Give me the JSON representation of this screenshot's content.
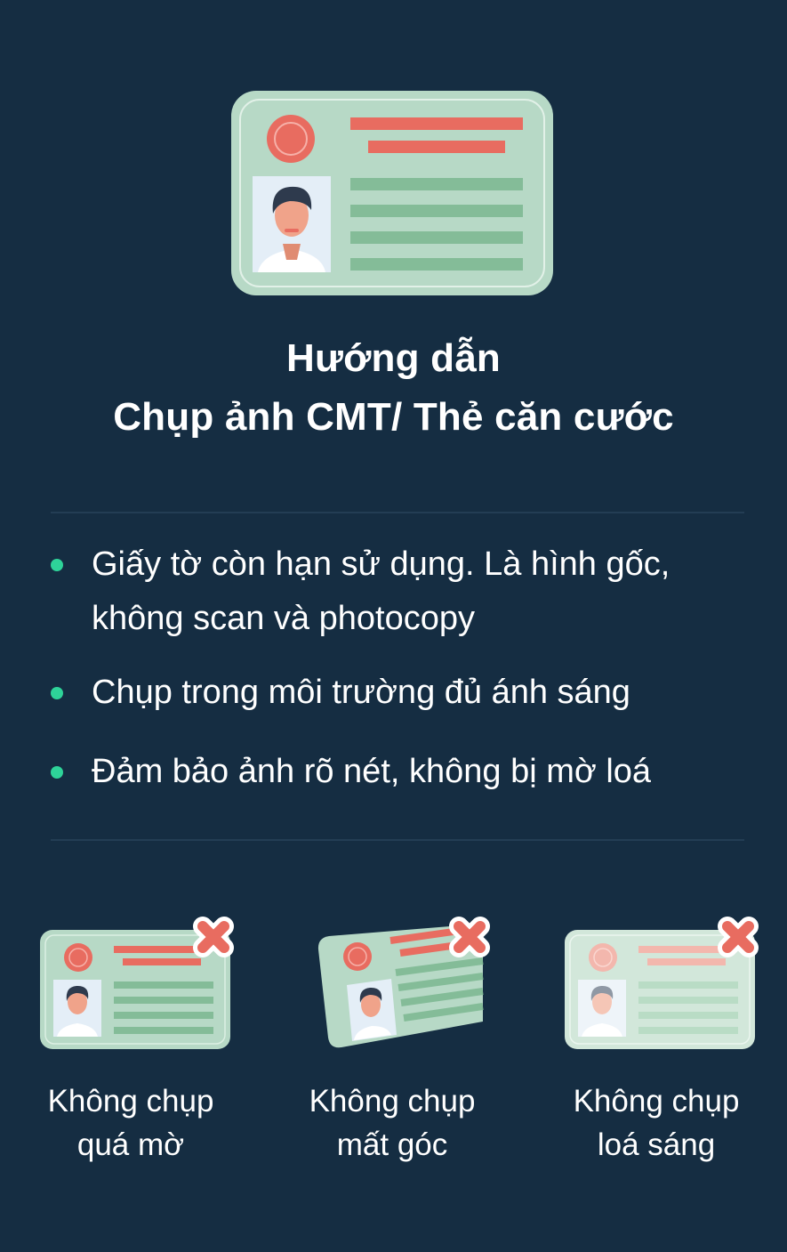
{
  "guide": {
    "title_line1": "Hướng dẫn",
    "title_line2": "Chụp ảnh CMT/ Thẻ căn cước"
  },
  "tips": [
    {
      "line1": "Giấy tờ còn hạn sử dụng. Là hình gốc,",
      "line2": "không scan và photocopy"
    },
    {
      "line1": "Chụp trong môi trường đủ ánh sáng"
    },
    {
      "line1": "Đảm bảo ảnh rõ nét, không bị mờ loá"
    }
  ],
  "warnings": [
    {
      "line1": "Không chụp",
      "line2": "quá mờ",
      "icon": "blurry-id-card-icon"
    },
    {
      "line1": "Không chụp",
      "line2": "mất góc",
      "icon": "tilted-id-card-icon"
    },
    {
      "line1": "Không chụp",
      "line2": "loá sáng",
      "icon": "glare-id-card-icon"
    }
  ],
  "colors": {
    "background": "#152d42",
    "card": "#b7d9c6",
    "accent_red": "#e86c60",
    "line_green": "#84bc98",
    "bullet": "#2ed399"
  }
}
